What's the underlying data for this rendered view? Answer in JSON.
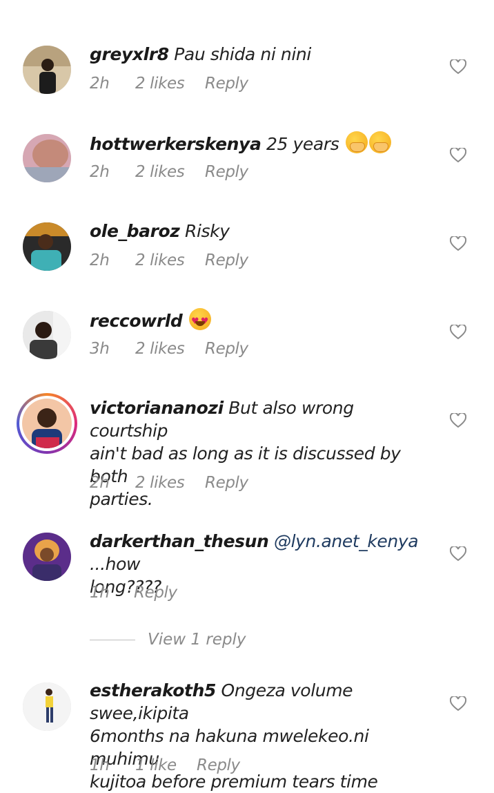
{
  "comments": [
    {
      "user": "greyxlr8",
      "text": "Pau shida ni nini",
      "time": "2h",
      "likes": "2 likes",
      "reply": "Reply"
    },
    {
      "user": "hottwerkerskenya",
      "text": "25 years",
      "time": "2h",
      "likes": "2 likes",
      "reply": "Reply"
    },
    {
      "user": "ole_baroz",
      "text": "Risky",
      "time": "2h",
      "likes": "2 likes",
      "reply": "Reply"
    },
    {
      "user": "reccowrld",
      "text": "",
      "time": "3h",
      "likes": "2 likes",
      "reply": "Reply"
    },
    {
      "user": "victoriananozi",
      "text_line1": "But also wrong courtship",
      "text_line2": "ain't bad as long as  it is discussed by both",
      "text_line3": "parties.",
      "time": "2h",
      "likes": "2 likes",
      "reply": "Reply"
    },
    {
      "user": "darkerthan_thesun",
      "mention": "@lyn.anet_kenya",
      "text_line1": " ...how",
      "text_line2": "long????",
      "time": "1h",
      "reply": "Reply",
      "view_replies": "View 1 reply"
    },
    {
      "user": "estherakoth5",
      "text_line1": "Ongeza volume swee,ikipita",
      "text_line2": "6months na hakuna mwelekeo.ni muhimu",
      "text_line3": "kujitoa before premium tears time",
      "time": "1h",
      "likes": "1 like",
      "reply": "Reply"
    }
  ],
  "icons": {
    "like": "heart-outline-icon",
    "emoji_1": "hand-over-mouth-emoji",
    "emoji_2": "heart-eyes-emoji"
  },
  "colors": {
    "muted": "#8a8a8a",
    "mention": "#1e3a5f"
  }
}
